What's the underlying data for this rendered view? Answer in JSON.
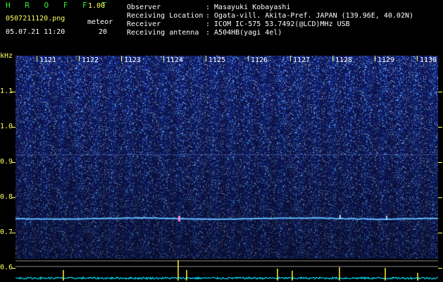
{
  "header": {
    "app_name": "H R O F F T",
    "version": "1.00",
    "filename": "0507211120.png",
    "datetime": "05.07.21 11:20",
    "meteor_label": "meteor",
    "meteor_count": "20"
  },
  "info": [
    {
      "label": "Observer",
      "value": ": Masayuki Kobayashi"
    },
    {
      "label": "Receiving Location",
      "value": ": Ogata-vill. Akita-Pref. JAPAN (139.96E, 40.02N)"
    },
    {
      "label": "Receiver",
      "value": ": ICOM IC-575 53.7492(@LCD)MHz USB"
    },
    {
      "label": "Receiving antenna",
      "value": ": A504HB(yagi 4el)"
    }
  ],
  "y_axis": {
    "unit": "kHz",
    "ticks": [
      "1.1",
      "1.0",
      "0.9",
      "0.8",
      "0.7",
      "0.6"
    ]
  },
  "time_axis": {
    "labels": [
      "1121",
      "1122",
      "1123",
      "1124",
      "1125",
      "1126",
      "1127",
      "1128",
      "1129",
      "1130"
    ]
  },
  "colors": {
    "background": "#000000",
    "header_green": "#33ee33",
    "header_yellow": "#ffff66",
    "spectrogram_base": "#0a0f55",
    "noise_bright": "#9fd3ff",
    "carrier": "#5fb7ff",
    "power_trace": "#00e5ff",
    "meteor_spike": "#ffee33"
  }
}
